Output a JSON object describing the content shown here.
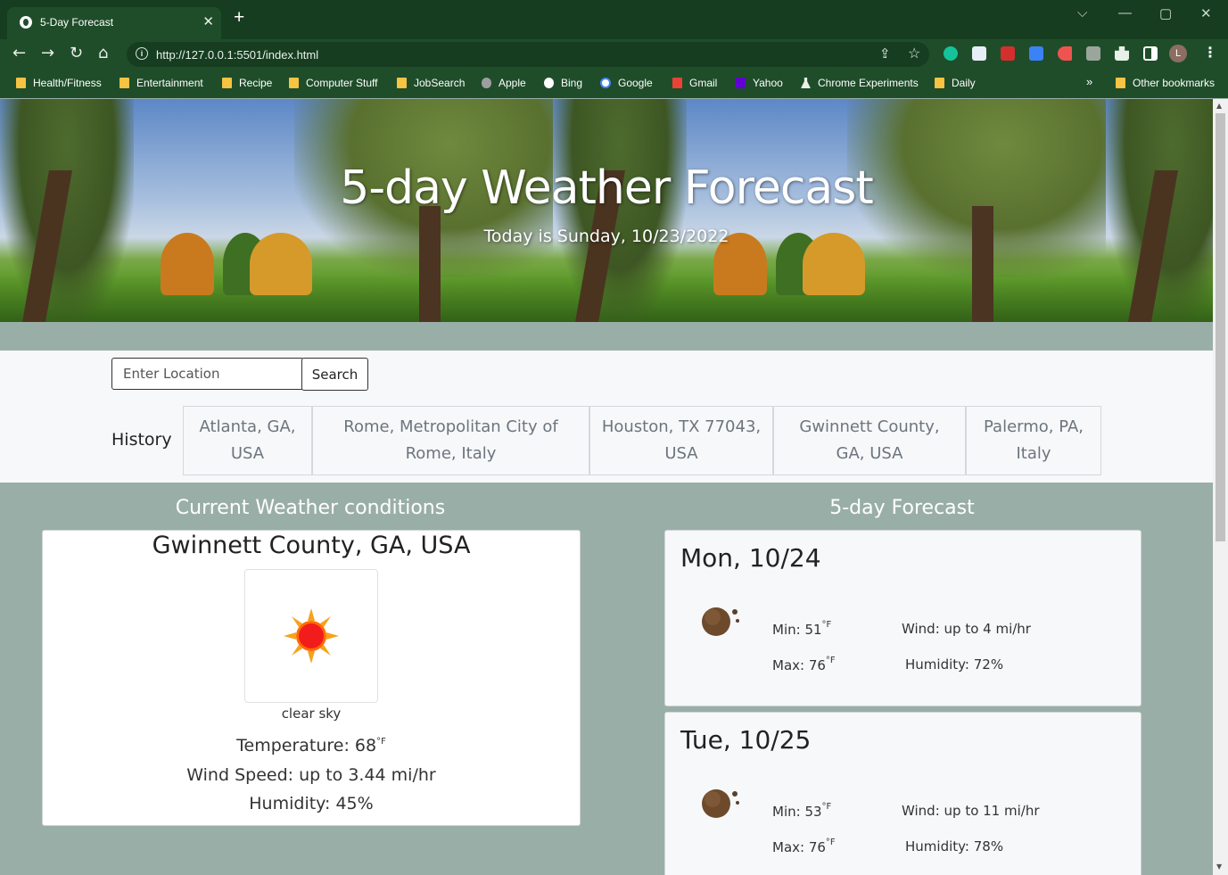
{
  "browser": {
    "tab_title": "5-Day Forecast",
    "tab_close": "✕",
    "new_tab": "+",
    "url": "http://127.0.0.1:5501/index.html",
    "profile_initial": "L",
    "window_controls": [
      "⌵",
      "—",
      "▢",
      "✕"
    ],
    "bookmarks": [
      {
        "label": "Health/Fitness",
        "icon": "folder-icon"
      },
      {
        "label": "Entertainment",
        "icon": "folder-icon"
      },
      {
        "label": "Recipe",
        "icon": "folder-icon"
      },
      {
        "label": "Computer Stuff",
        "icon": "folder-icon"
      },
      {
        "label": "JobSearch",
        "icon": "folder-icon"
      },
      {
        "label": "Apple",
        "icon": "apple-icon"
      },
      {
        "label": "Bing",
        "icon": "bing-icon"
      },
      {
        "label": "Google",
        "icon": "google-icon"
      },
      {
        "label": "Gmail",
        "icon": "gmail-icon"
      },
      {
        "label": "Yahoo",
        "icon": "yahoo-icon"
      },
      {
        "label": "Chrome Experiments",
        "icon": "flask-icon"
      },
      {
        "label": "Daily",
        "icon": "folder-icon"
      }
    ],
    "bookmarks_more": "»",
    "other_bookmarks": "Other bookmarks"
  },
  "hero": {
    "title": "5-day Weather Forecast",
    "subtitle": "Today is Sunday, 10/23/2022"
  },
  "search": {
    "placeholder": "Enter Location",
    "button_label": "Search"
  },
  "history": {
    "label": "History",
    "items": [
      "Atlanta, GA, USA",
      "Rome, Metropolitan City of Rome, Italy",
      "Houston, TX 77043, USA",
      "Gwinnett County, GA, USA",
      "Palermo, PA, Italy"
    ]
  },
  "current": {
    "heading": "Current Weather conditions",
    "city": "Gwinnett County, GA, USA",
    "description": "clear sky",
    "temperature_label": "Temperature: 68",
    "temperature_unit": "°F",
    "wind": "Wind Speed: up to 3.44 mi/hr",
    "humidity": "Humidity: 45%"
  },
  "forecast": {
    "heading": "5-day Forecast",
    "days": [
      {
        "date": "Mon, 10/24",
        "min": "Min: 51",
        "max": "Max: 76",
        "unit": "°F",
        "wind": "Wind: up to 4 mi/hr",
        "humidity": "Humidity: 72%"
      },
      {
        "date": "Tue, 10/25",
        "min": "Min: 53",
        "max": "Max: 76",
        "unit": "°F",
        "wind": "Wind: up to 11 mi/hr",
        "humidity": "Humidity: 78%"
      }
    ]
  },
  "colors": {
    "browser_frame": "#1f4d2a",
    "page_background": "#9aaea8",
    "panel": "#f7f8fa"
  }
}
